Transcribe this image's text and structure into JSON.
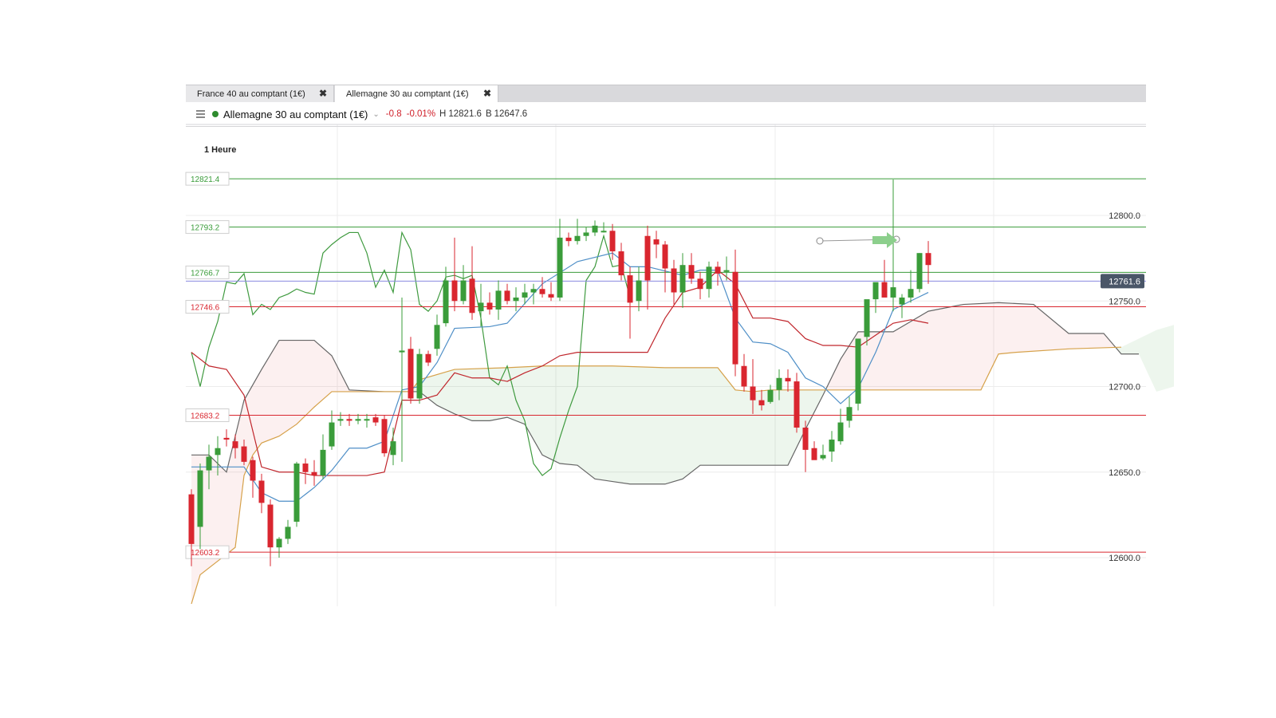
{
  "tabs": [
    {
      "label": "France 40 au comptant (1€)",
      "close": "✖"
    },
    {
      "label": "Allemagne 30 au comptant (1€)",
      "close": "✖"
    }
  ],
  "header": {
    "instrument": "Allemagne 30 au comptant (1€)",
    "change": "-0.8",
    "change_pct": "-0.01%",
    "high_label": "H",
    "high": "12821.6",
    "low_label": "B",
    "low": "12647.6"
  },
  "colors": {
    "up": "#3a9c3a",
    "down": "#d9262f",
    "tenkan": "#4f8fc7",
    "kijun": "#c0262c",
    "chikou": "#3f9a3f",
    "spanA": "#d6a14a",
    "spanB": "#666666"
  },
  "chart_data": {
    "type": "candlestick",
    "timeframe": "1 Heure",
    "ylim": [
      12573,
      12810
    ],
    "y_ticks": [
      12800.0,
      12750.0,
      12700.0,
      12650.0,
      12600.0
    ],
    "y_tick_labels": [
      "12800.0",
      "12750.0",
      "12700.0",
      "12650.0",
      "12600.0"
    ],
    "current_price": "12761.6",
    "levels": [
      {
        "value": "12821.4",
        "color": "#3a9c3a"
      },
      {
        "value": "12793.2",
        "color": "#3a9c3a"
      },
      {
        "value": "12766.7",
        "color": "#3a9c3a"
      },
      {
        "value": "12746.6",
        "color": "#d9262f"
      },
      {
        "value": "12683.2",
        "color": "#d9262f"
      },
      {
        "value": "12603.2",
        "color": "#d9262f"
      }
    ],
    "candles": [
      [
        12637,
        12640,
        12595,
        12608
      ],
      [
        12618,
        12655,
        12605,
        12651
      ],
      [
        12651,
        12666,
        12640,
        12659
      ],
      [
        12660,
        12671,
        12648,
        12664
      ],
      [
        12670,
        12675,
        12665,
        12669
      ],
      [
        12668,
        12672,
        12658,
        12664
      ],
      [
        12665,
        12669,
        12654,
        12656
      ],
      [
        12657,
        12659,
        12635,
        12645
      ],
      [
        12645,
        12649,
        12626,
        12632
      ],
      [
        12631,
        12634,
        12595,
        12606
      ],
      [
        12606,
        12612,
        12600,
        12611
      ],
      [
        12611,
        12622,
        12608,
        12618
      ],
      [
        12621,
        12656,
        12618,
        12655
      ],
      [
        12655,
        12658,
        12643,
        12650
      ],
      [
        12650,
        12657,
        12642,
        12648
      ],
      [
        12648,
        12672,
        12646,
        12663
      ],
      [
        12665,
        12686,
        12663,
        12679
      ],
      [
        12680,
        12685,
        12677,
        12681
      ],
      [
        12681,
        12684,
        12677,
        12680
      ],
      [
        12680,
        12684,
        12678,
        12681
      ],
      [
        12681,
        12684,
        12676,
        12681
      ],
      [
        12682,
        12684,
        12677,
        12679
      ],
      [
        12681,
        12683,
        12659,
        12661
      ],
      [
        12660,
        12676,
        12654,
        12668
      ],
      [
        12720,
        12752,
        12656,
        12721
      ],
      [
        12722,
        12729,
        12690,
        12693
      ],
      [
        12693,
        12722,
        12690,
        12719
      ],
      [
        12719,
        12721,
        12712,
        12714
      ],
      [
        12722,
        12742,
        12718,
        12736
      ],
      [
        12737,
        12770,
        12735,
        12762
      ],
      [
        12762,
        12787,
        12744,
        12750
      ],
      [
        12750,
        12771,
        12748,
        12762
      ],
      [
        12763,
        12782,
        12739,
        12743
      ],
      [
        12744,
        12760,
        12735,
        12749
      ],
      [
        12749,
        12755,
        12742,
        12745
      ],
      [
        12745,
        12762,
        12739,
        12756
      ],
      [
        12756,
        12760,
        12748,
        12750
      ],
      [
        12750,
        12758,
        12744,
        12752
      ],
      [
        12752,
        12760,
        12748,
        12755
      ],
      [
        12755,
        12760,
        12748,
        12757
      ],
      [
        12757,
        12764,
        12752,
        12754
      ],
      [
        12754,
        12761,
        12750,
        12752
      ],
      [
        12752,
        12798,
        12750,
        12787
      ],
      [
        12787,
        12790,
        12782,
        12785
      ],
      [
        12785,
        12798,
        12783,
        12788
      ],
      [
        12788,
        12793,
        12785,
        12790
      ],
      [
        12790,
        12797,
        12788,
        12794
      ],
      [
        12791,
        12796,
        12790,
        12791
      ],
      [
        12791,
        12795,
        12774,
        12779
      ],
      [
        12779,
        12784,
        12762,
        12765
      ],
      [
        12765,
        12770,
        12728,
        12749
      ],
      [
        12750,
        12770,
        12744,
        12762
      ],
      [
        12788,
        12794,
        12745,
        12762
      ],
      [
        12786,
        12791,
        12775,
        12783
      ],
      [
        12783,
        12785,
        12755,
        12769
      ],
      [
        12769,
        12774,
        12748,
        12755
      ],
      [
        12755,
        12778,
        12746,
        12771
      ],
      [
        12771,
        12778,
        12760,
        12763
      ],
      [
        12763,
        12767,
        12751,
        12757
      ],
      [
        12757,
        12773,
        12752,
        12770
      ],
      [
        12770,
        12773,
        12759,
        12766
      ],
      [
        12767,
        12776,
        12762,
        12768
      ],
      [
        12767,
        12780,
        12706,
        12713
      ],
      [
        12712,
        12719,
        12697,
        12700
      ],
      [
        12700,
        12716,
        12684,
        12692
      ],
      [
        12692,
        12698,
        12686,
        12689
      ],
      [
        12691,
        12701,
        12690,
        12698
      ],
      [
        12698,
        12710,
        12692,
        12705
      ],
      [
        12705,
        12710,
        12697,
        12703
      ],
      [
        12703,
        12708,
        12673,
        12676
      ],
      [
        12676,
        12680,
        12650,
        12663
      ],
      [
        12664,
        12668,
        12660,
        12657
      ],
      [
        12658,
        12666,
        12657,
        12660
      ],
      [
        12662,
        12674,
        12656,
        12669
      ],
      [
        12668,
        12687,
        12666,
        12679
      ],
      [
        12680,
        12694,
        12676,
        12688
      ],
      [
        12690,
        12723,
        12686,
        12728
      ],
      [
        12729,
        12749,
        12724,
        12751
      ],
      [
        12751,
        12760,
        12743,
        12761
      ],
      [
        12761,
        12774,
        12756,
        12752
      ],
      [
        12752,
        12821,
        12744,
        12758
      ],
      [
        12748,
        12754,
        12740,
        12752
      ],
      [
        12752,
        12768,
        12749,
        12757
      ],
      [
        12757,
        12778,
        12755,
        12778
      ],
      [
        12778,
        12785,
        12760,
        12771
      ]
    ],
    "ichimoku": {
      "tenkan": [
        [
          0,
          12653
        ],
        [
          3,
          12653
        ],
        [
          6,
          12653
        ],
        [
          8,
          12638
        ],
        [
          10,
          12633
        ],
        [
          12,
          12633
        ],
        [
          14,
          12641
        ],
        [
          16,
          12651
        ],
        [
          18,
          12664
        ],
        [
          20,
          12664
        ],
        [
          22,
          12668
        ],
        [
          24,
          12698
        ],
        [
          26,
          12700
        ],
        [
          28,
          12714
        ],
        [
          30,
          12734
        ],
        [
          34,
          12735
        ],
        [
          36,
          12737
        ],
        [
          40,
          12760
        ],
        [
          44,
          12773
        ],
        [
          48,
          12778
        ],
        [
          50,
          12770
        ],
        [
          52,
          12770
        ],
        [
          56,
          12765
        ],
        [
          58,
          12768
        ],
        [
          60,
          12768
        ],
        [
          62,
          12740
        ],
        [
          64,
          12726
        ],
        [
          66,
          12725
        ],
        [
          68,
          12720
        ],
        [
          70,
          12705
        ],
        [
          72,
          12700
        ],
        [
          74,
          12690
        ],
        [
          76,
          12699
        ],
        [
          78,
          12720
        ],
        [
          80,
          12745
        ],
        [
          82,
          12750
        ],
        [
          84,
          12755
        ]
      ],
      "kijun": [
        [
          0,
          12720
        ],
        [
          2,
          12712
        ],
        [
          4,
          12710
        ],
        [
          6,
          12695
        ],
        [
          8,
          12653
        ],
        [
          10,
          12650
        ],
        [
          12,
          12650
        ],
        [
          14,
          12648
        ],
        [
          16,
          12648
        ],
        [
          20,
          12648
        ],
        [
          22,
          12650
        ],
        [
          24,
          12692
        ],
        [
          26,
          12692
        ],
        [
          28,
          12695
        ],
        [
          30,
          12708
        ],
        [
          32,
          12705
        ],
        [
          34,
          12705
        ],
        [
          36,
          12703
        ],
        [
          38,
          12708
        ],
        [
          40,
          12712
        ],
        [
          42,
          12718
        ],
        [
          44,
          12720
        ],
        [
          48,
          12720
        ],
        [
          52,
          12720
        ],
        [
          54,
          12740
        ],
        [
          56,
          12755
        ],
        [
          58,
          12758
        ],
        [
          60,
          12768
        ],
        [
          62,
          12760
        ],
        [
          64,
          12740
        ],
        [
          66,
          12740
        ],
        [
          68,
          12738
        ],
        [
          70,
          12728
        ],
        [
          72,
          12724
        ],
        [
          74,
          12724
        ],
        [
          76,
          12723
        ],
        [
          78,
          12730
        ],
        [
          80,
          12737
        ],
        [
          82,
          12739
        ],
        [
          84,
          12737
        ]
      ],
      "chikou": [
        [
          0,
          12720
        ],
        [
          1,
          12700
        ],
        [
          2,
          12723
        ],
        [
          3,
          12738
        ],
        [
          4,
          12761
        ],
        [
          5,
          12760
        ],
        [
          6,
          12766
        ],
        [
          7,
          12742
        ],
        [
          8,
          12748
        ],
        [
          9,
          12745
        ],
        [
          10,
          12752
        ],
        [
          11,
          12754
        ],
        [
          12,
          12757
        ],
        [
          13,
          12755
        ],
        [
          14,
          12754
        ],
        [
          15,
          12778
        ],
        [
          16,
          12783
        ],
        [
          17,
          12787
        ],
        [
          18,
          12790
        ],
        [
          19,
          12790
        ],
        [
          20,
          12778
        ],
        [
          21,
          12758
        ],
        [
          22,
          12768
        ],
        [
          23,
          12755
        ],
        [
          24,
          12790
        ],
        [
          25,
          12780
        ],
        [
          26,
          12748
        ],
        [
          27,
          12744
        ],
        [
          28,
          12750
        ],
        [
          29,
          12764
        ],
        [
          30,
          12765
        ],
        [
          31,
          12763
        ],
        [
          32,
          12765
        ],
        [
          33,
          12740
        ],
        [
          34,
          12705
        ],
        [
          35,
          12701
        ],
        [
          36,
          12712
        ],
        [
          37,
          12692
        ],
        [
          38,
          12680
        ],
        [
          39,
          12655
        ],
        [
          40,
          12648
        ],
        [
          41,
          12652
        ],
        [
          42,
          12670
        ],
        [
          43,
          12686
        ],
        [
          44,
          12700
        ],
        [
          45,
          12762
        ],
        [
          46,
          12770
        ],
        [
          47,
          12788
        ],
        [
          48,
          12770
        ],
        [
          49,
          12771
        ],
        [
          50,
          12752
        ]
      ],
      "span_a": [
        [
          0,
          12573
        ],
        [
          1,
          12590
        ],
        [
          3,
          12598
        ],
        [
          5,
          12606
        ],
        [
          6,
          12648
        ],
        [
          7,
          12660
        ],
        [
          8,
          12667
        ],
        [
          10,
          12671
        ],
        [
          12,
          12678
        ],
        [
          14,
          12688
        ],
        [
          16,
          12697
        ],
        [
          20,
          12697
        ],
        [
          22,
          12697
        ],
        [
          25,
          12697
        ],
        [
          26,
          12704
        ],
        [
          30,
          12710
        ],
        [
          36,
          12711
        ],
        [
          40,
          12712
        ],
        [
          48,
          12712
        ],
        [
          54,
          12711
        ],
        [
          60,
          12711
        ],
        [
          62,
          12698
        ],
        [
          64,
          12697
        ],
        [
          66,
          12698
        ],
        [
          70,
          12698
        ],
        [
          78,
          12698
        ],
        [
          84,
          12698
        ],
        [
          90,
          12698
        ],
        [
          92,
          12719
        ],
        [
          94,
          12720
        ],
        [
          100,
          12722
        ],
        [
          106,
          12723
        ],
        [
          110,
          12733
        ],
        [
          112,
          12736
        ]
      ],
      "span_b": [
        [
          0,
          12660
        ],
        [
          2,
          12660
        ],
        [
          4,
          12650
        ],
        [
          6,
          12692
        ],
        [
          8,
          12710
        ],
        [
          10,
          12727
        ],
        [
          14,
          12727
        ],
        [
          16,
          12718
        ],
        [
          18,
          12698
        ],
        [
          22,
          12697
        ],
        [
          26,
          12697
        ],
        [
          28,
          12689
        ],
        [
          30,
          12684
        ],
        [
          32,
          12680
        ],
        [
          34,
          12680
        ],
        [
          36,
          12682
        ],
        [
          38,
          12678
        ],
        [
          40,
          12660
        ],
        [
          42,
          12655
        ],
        [
          44,
          12654
        ],
        [
          46,
          12646
        ],
        [
          50,
          12643
        ],
        [
          54,
          12643
        ],
        [
          56,
          12646
        ],
        [
          58,
          12654
        ],
        [
          60,
          12654
        ],
        [
          64,
          12654
        ],
        [
          68,
          12654
        ],
        [
          70,
          12675
        ],
        [
          72,
          12695
        ],
        [
          74,
          12716
        ],
        [
          76,
          12732
        ],
        [
          80,
          12732
        ],
        [
          84,
          12744
        ],
        [
          88,
          12748
        ],
        [
          92,
          12749
        ],
        [
          96,
          12748
        ],
        [
          100,
          12731
        ],
        [
          104,
          12731
        ],
        [
          106,
          12719
        ],
        [
          108,
          12719
        ],
        [
          110,
          12697
        ],
        [
          112,
          12700
        ],
        [
          116,
          12700
        ],
        [
          118,
          12718
        ],
        [
          121,
          12733
        ],
        [
          124,
          12737
        ]
      ]
    }
  }
}
